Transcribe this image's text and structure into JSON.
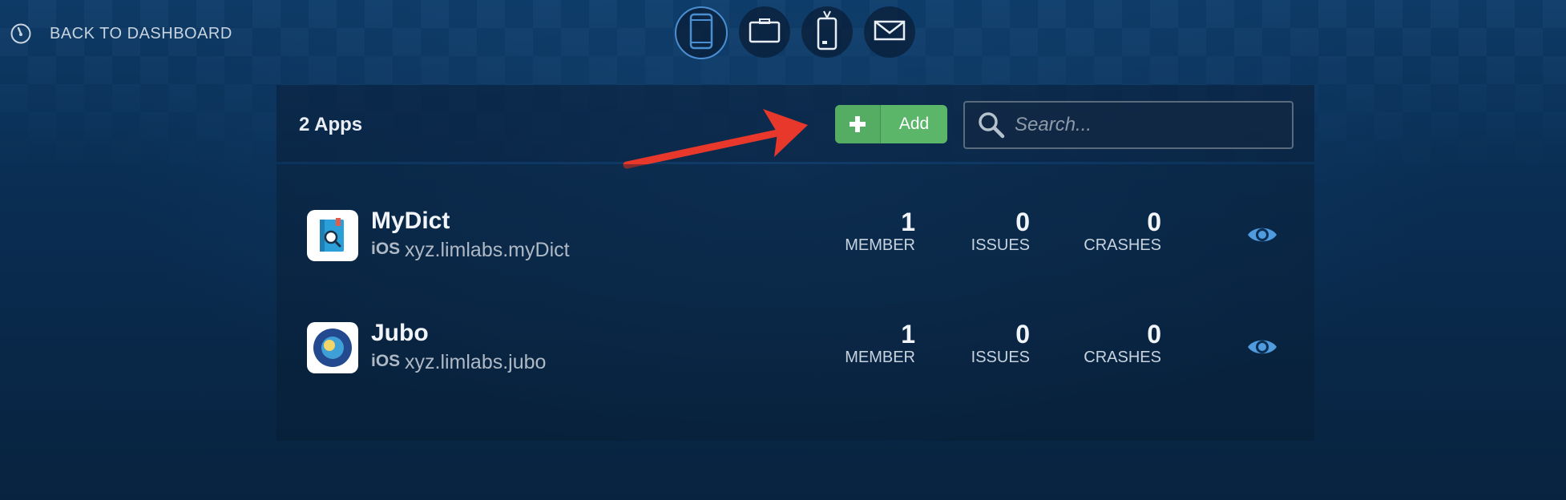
{
  "header": {
    "back_label": "BACK TO DASHBOARD",
    "nav_icons": [
      "phone-icon",
      "briefcase-icon",
      "badge-icon",
      "mail-icon"
    ]
  },
  "toolbar": {
    "count_label": "2 Apps",
    "add_label": "Add",
    "search_placeholder": "Search..."
  },
  "apps": [
    {
      "name": "MyDict",
      "platform": "iOS",
      "bundle_id": "xyz.limlabs.myDict",
      "member_count": "1",
      "member_label": "MEMBER",
      "issues_count": "0",
      "issues_label": "ISSUES",
      "crashes_count": "0",
      "crashes_label": "CRASHES"
    },
    {
      "name": "Jubo",
      "platform": "iOS",
      "bundle_id": "xyz.limlabs.jubo",
      "member_count": "1",
      "member_label": "MEMBER",
      "issues_count": "0",
      "issues_label": "ISSUES",
      "crashes_count": "0",
      "crashes_label": "CRASHES"
    }
  ],
  "colors": {
    "accent": "#4a8fd1",
    "add_button": "#5bb66a",
    "annotation_arrow": "#e8372b",
    "background": "#0b2d52"
  }
}
